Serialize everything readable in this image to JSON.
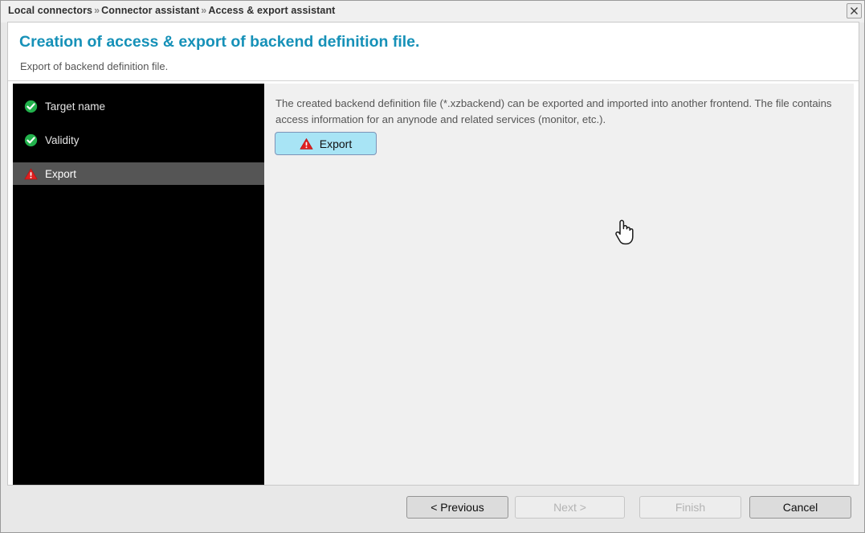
{
  "titlebar": {
    "breadcrumb": [
      "Local connectors",
      "Connector assistant",
      "Access & export assistant"
    ],
    "separator": "»",
    "close_label": "close-window"
  },
  "header": {
    "title": "Creation of access & export of backend definition file.",
    "subtitle": "Export of backend definition file.",
    "title_color": "#1691b8"
  },
  "sidebar": {
    "items": [
      {
        "label": "Target name",
        "status": "done",
        "icon": "check-circle-icon",
        "active": false
      },
      {
        "label": "Validity",
        "status": "done",
        "icon": "check-circle-icon",
        "active": false
      },
      {
        "label": "Export",
        "status": "warning",
        "icon": "warning-triangle-icon",
        "active": true
      }
    ],
    "status_colors": {
      "done": "#22b14c",
      "warning": "#e02020"
    },
    "background": "#000000",
    "active_background": "#555555"
  },
  "main": {
    "description": "The created backend definition file (*.xzbackend) can be exported and imported into another frontend. The file contains access information for an anynode and related services (monitor, etc.).",
    "export_button": {
      "label": "Export",
      "icon": "warning-triangle-icon",
      "background": "#a8e4f5",
      "state": "hover"
    },
    "cursor": "hand-pointer-cursor"
  },
  "footer": {
    "buttons": [
      {
        "label": "< Previous",
        "enabled": true
      },
      {
        "label": "Next >",
        "enabled": false
      },
      {
        "label": "Finish",
        "enabled": false
      },
      {
        "label": "Cancel",
        "enabled": true
      }
    ]
  }
}
